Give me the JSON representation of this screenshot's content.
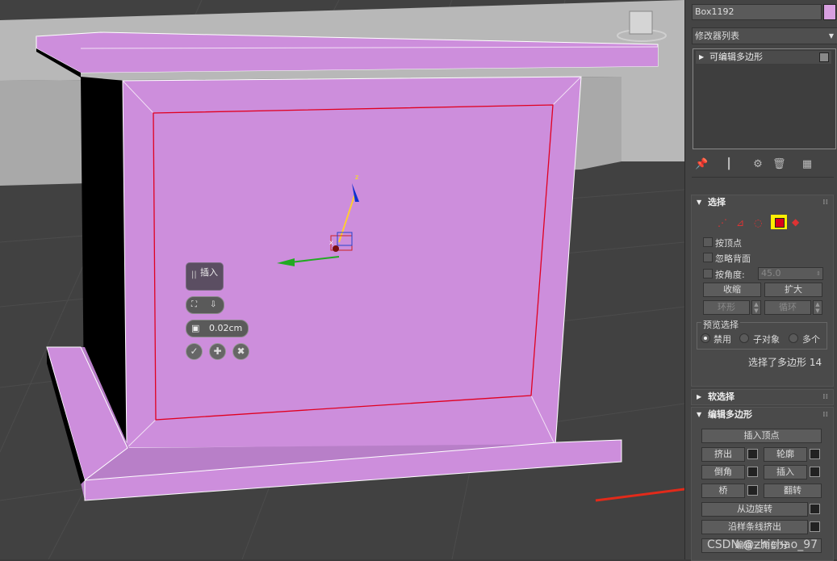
{
  "viewport": {
    "caddy": {
      "title": "插入",
      "amount": "0.02cm"
    },
    "gizmo": {
      "z_label": "z",
      "x_label": "x"
    }
  },
  "panel": {
    "object_name": "Box1192",
    "object_color": "#d8a0e0",
    "modifier_list": "修改器列表",
    "stack_item": "可编辑多边形",
    "selection": {
      "title": "选择",
      "by_vertex": "按顶点",
      "ignore_backfacing": "忽略背面",
      "by_angle": "按角度:",
      "angle_value": "45.0",
      "shrink": "收缩",
      "grow": "扩大",
      "ring": "环形",
      "loop": "循环",
      "preview_title": "预览选择",
      "preview_disabled": "禁用",
      "preview_subobject": "子对象",
      "preview_multi": "多个",
      "status": "选择了多边形 14"
    },
    "soft_selection": {
      "title": "软选择"
    },
    "edit_polygons": {
      "title": "编辑多边形",
      "insert_vertex": "插入顶点",
      "extrude": "挤出",
      "outline": "轮廓",
      "bevel": "倒角",
      "inset": "插入",
      "bridge": "桥",
      "flip": "翻转",
      "hinge_from_edge": "从边旋转",
      "extrude_along_spline": "沿样条线挤出",
      "edit_triangulation": "编辑三角剖分"
    }
  },
  "watermark": "CSDN @zhichao_97",
  "colors": {
    "accent": "#ffee00",
    "poly_select": "#d9001b",
    "object": "#cd8edc"
  }
}
